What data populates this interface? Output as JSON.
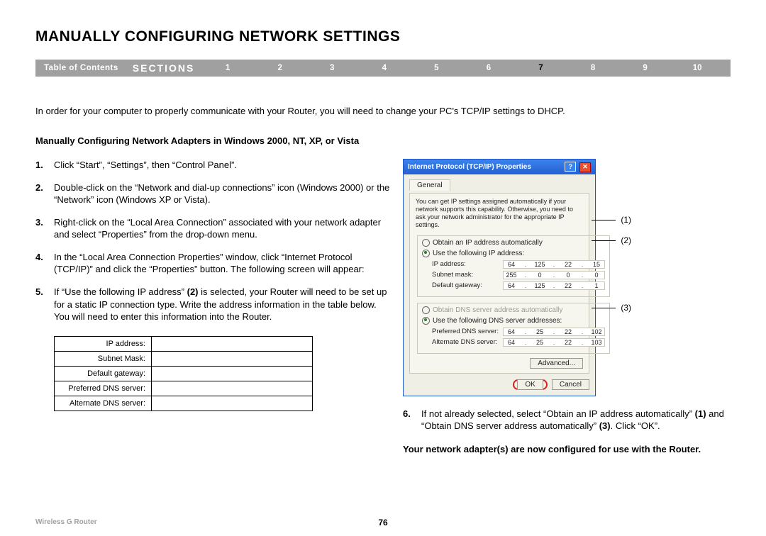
{
  "title": "MANUALLY CONFIGURING NETWORK SETTINGS",
  "nav": {
    "toc": "Table of Contents",
    "sections_label": "SECTIONS",
    "sections": [
      "1",
      "2",
      "3",
      "4",
      "5",
      "6",
      "7",
      "8",
      "9",
      "10"
    ],
    "active_index": 6
  },
  "intro": "In order for your computer to properly communicate with your Router, you will need to change your PC's TCP/IP settings to DHCP.",
  "sub_head": "Manually Configuring Network Adapters in Windows 2000, NT, XP, or Vista",
  "steps": {
    "s1": "Click “Start”, “Settings”, then “Control Panel”.",
    "s2": "Double-click on the “Network and dial-up connections” icon (Windows 2000) or the “Network” icon (Windows XP or Vista).",
    "s3": "Right-click on the “Local Area Connection” associated with your network adapter and select “Properties” from the drop-down menu.",
    "s4": "In the “Local Area Connection Properties” window, click “Internet Protocol (TCP/IP)” and click the “Properties” button. The following screen will appear:",
    "s5_prefix": "If “Use the following IP address” ",
    "s5_bold": "(2)",
    "s5_suffix": " is selected, your Router will need to be set up for a static IP connection type. Write the address information in the table below. You will need to enter this information into the Router.",
    "s6_prefix": "If not already selected, select “Obtain an IP address automatically” ",
    "s6_b1": "(1)",
    "s6_mid": " and “Obtain DNS server address automatically” ",
    "s6_b2": "(3)",
    "s6_suffix": ". Click “OK”."
  },
  "blank_table": {
    "rows": [
      "IP address:",
      "Subnet Mask:",
      "Default gateway:",
      "Preferred DNS server:",
      "Alternate DNS server:"
    ]
  },
  "dialog": {
    "title": "Internet Protocol (TCP/IP) Properties",
    "tab": "General",
    "desc": "You can get IP settings assigned automatically if your network supports this capability. Otherwise, you need to ask your network administrator for the appropriate IP settings.",
    "radio_auto_ip": "Obtain an IP address automatically",
    "radio_use_ip": "Use the following IP address:",
    "lbl_ip": "IP address:",
    "lbl_subnet": "Subnet mask:",
    "lbl_gw": "Default gateway:",
    "radio_auto_dns": "Obtain DNS server address automatically",
    "radio_use_dns": "Use the following DNS server addresses:",
    "lbl_pdns": "Preferred DNS server:",
    "lbl_adns": "Alternate DNS server:",
    "ip": [
      "64",
      "125",
      "22",
      "15"
    ],
    "subnet": [
      "255",
      "0",
      "0",
      "0"
    ],
    "gw": [
      "64",
      "125",
      "22",
      "1"
    ],
    "pdns": [
      "64",
      "25",
      "22",
      "102"
    ],
    "adns": [
      "64",
      "25",
      "22",
      "103"
    ],
    "btn_adv": "Advanced...",
    "btn_ok": "OK",
    "btn_cancel": "Cancel"
  },
  "callouts": {
    "c1": "(1)",
    "c2": "(2)",
    "c3": "(3)"
  },
  "configured": "Your network adapter(s) are now configured for use with the Router.",
  "footer": {
    "product": "Wireless G Router",
    "page": "76"
  }
}
